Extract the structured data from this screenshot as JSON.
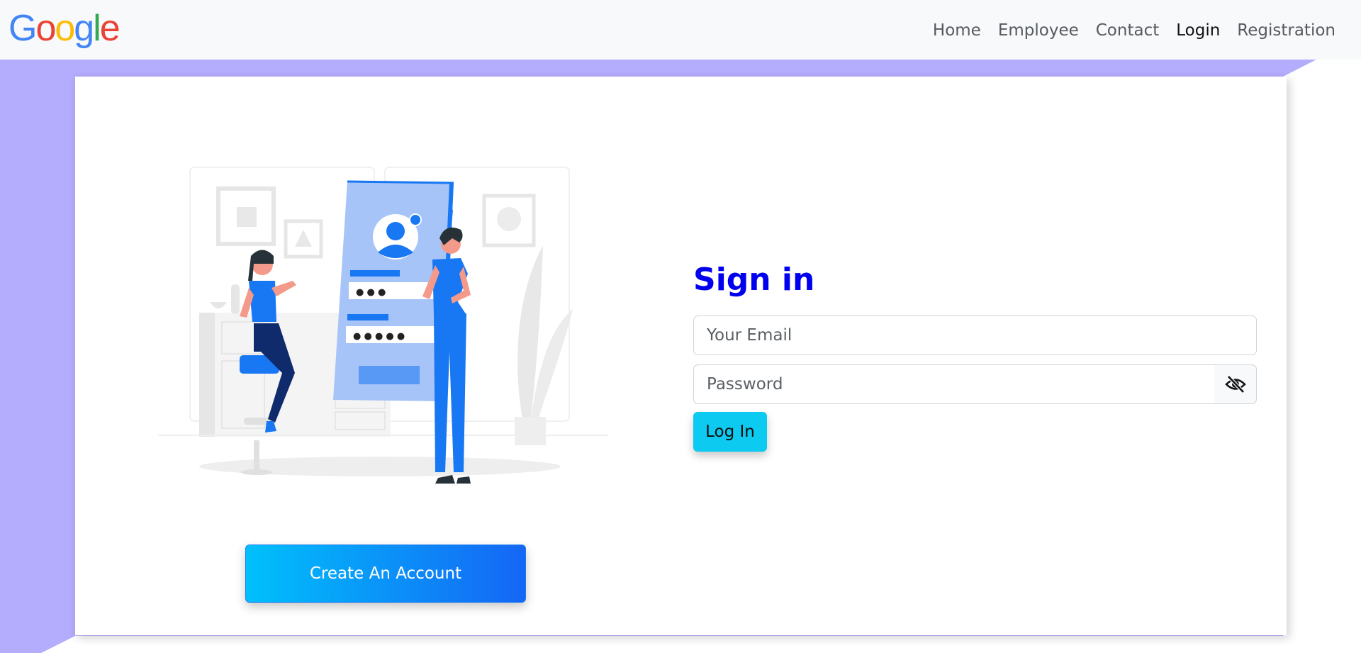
{
  "brand": {
    "logo_letters": [
      {
        "char": "G",
        "color": "#4285F4"
      },
      {
        "char": "o",
        "color": "#EA4335"
      },
      {
        "char": "o",
        "color": "#FBBC05"
      },
      {
        "char": "g",
        "color": "#4285F4"
      },
      {
        "char": "l",
        "color": "#34A853"
      },
      {
        "char": "e",
        "color": "#EA4335"
      }
    ]
  },
  "nav": {
    "items": [
      {
        "label": "Home"
      },
      {
        "label": "Employee"
      },
      {
        "label": "Contact"
      },
      {
        "label": "Login",
        "active": true
      },
      {
        "label": "Registration"
      }
    ]
  },
  "signin": {
    "title": "Sign in",
    "email_placeholder": "Your Email",
    "password_placeholder": "Password",
    "toggle_icon": "eye-slash-icon",
    "login_label": "Log In"
  },
  "create_account": {
    "label": "Create An Account"
  },
  "illustration": {
    "name": "login-illustration",
    "password_dots_1": "● ● ●",
    "password_dots_2": "● ● ● ● ●"
  },
  "colors": {
    "background_shape": "#b4acfc",
    "title": "#0000ee",
    "login_button": "#0dcaf0",
    "create_gradient_start": "#00c0fb",
    "create_gradient_end": "#1566f5",
    "illustration_blue": "#1877f2"
  }
}
